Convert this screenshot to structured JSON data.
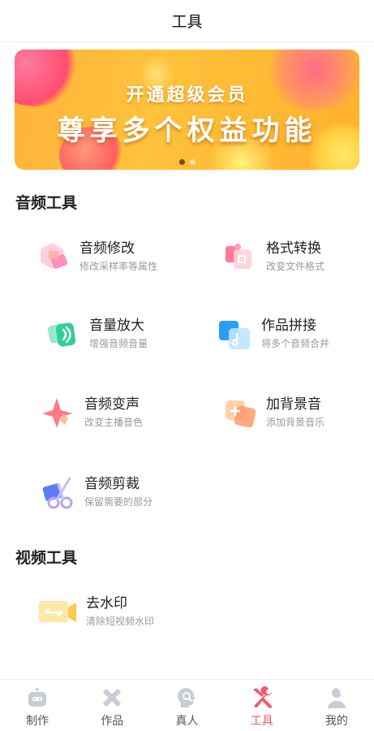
{
  "header": {
    "title": "工具"
  },
  "banner": {
    "line1": "开通超级会员",
    "line2": "尊享多个权益功能",
    "pages": 2,
    "active_page": 1
  },
  "audio_section": {
    "title": "音频工具",
    "tools": [
      {
        "name": "音频修改",
        "desc": "修改采样率等属性",
        "icon": "audio-edit-icon"
      },
      {
        "name": "格式转换",
        "desc": "改变文件格式",
        "icon": "format-convert-icon"
      },
      {
        "name": "音量放大",
        "desc": "增强音频音量",
        "icon": "volume-up-icon"
      },
      {
        "name": "作品拼接",
        "desc": "将多个音频合并",
        "icon": "merge-icon"
      },
      {
        "name": "音频变声",
        "desc": "改变主播音色",
        "icon": "voice-change-icon"
      },
      {
        "name": "加背景音",
        "desc": "添加背景音乐",
        "icon": "add-bgm-icon"
      },
      {
        "name": "音频剪裁",
        "desc": "保留需要的部分",
        "icon": "scissors-icon"
      }
    ]
  },
  "video_section": {
    "title": "视频工具",
    "tools": [
      {
        "name": "去水印",
        "desc": "清除短视频水印",
        "icon": "video-camera-icon"
      }
    ]
  },
  "tabbar": {
    "active": "工具",
    "active_color": "#f25a6a",
    "items": [
      {
        "label": "制作",
        "icon": "robot-icon"
      },
      {
        "label": "作品",
        "icon": "cross-tools-icon"
      },
      {
        "label": "真人",
        "icon": "head-search-icon"
      },
      {
        "label": "工具",
        "icon": "wrench-screwdriver-icon"
      },
      {
        "label": "我的",
        "icon": "user-icon"
      }
    ]
  }
}
